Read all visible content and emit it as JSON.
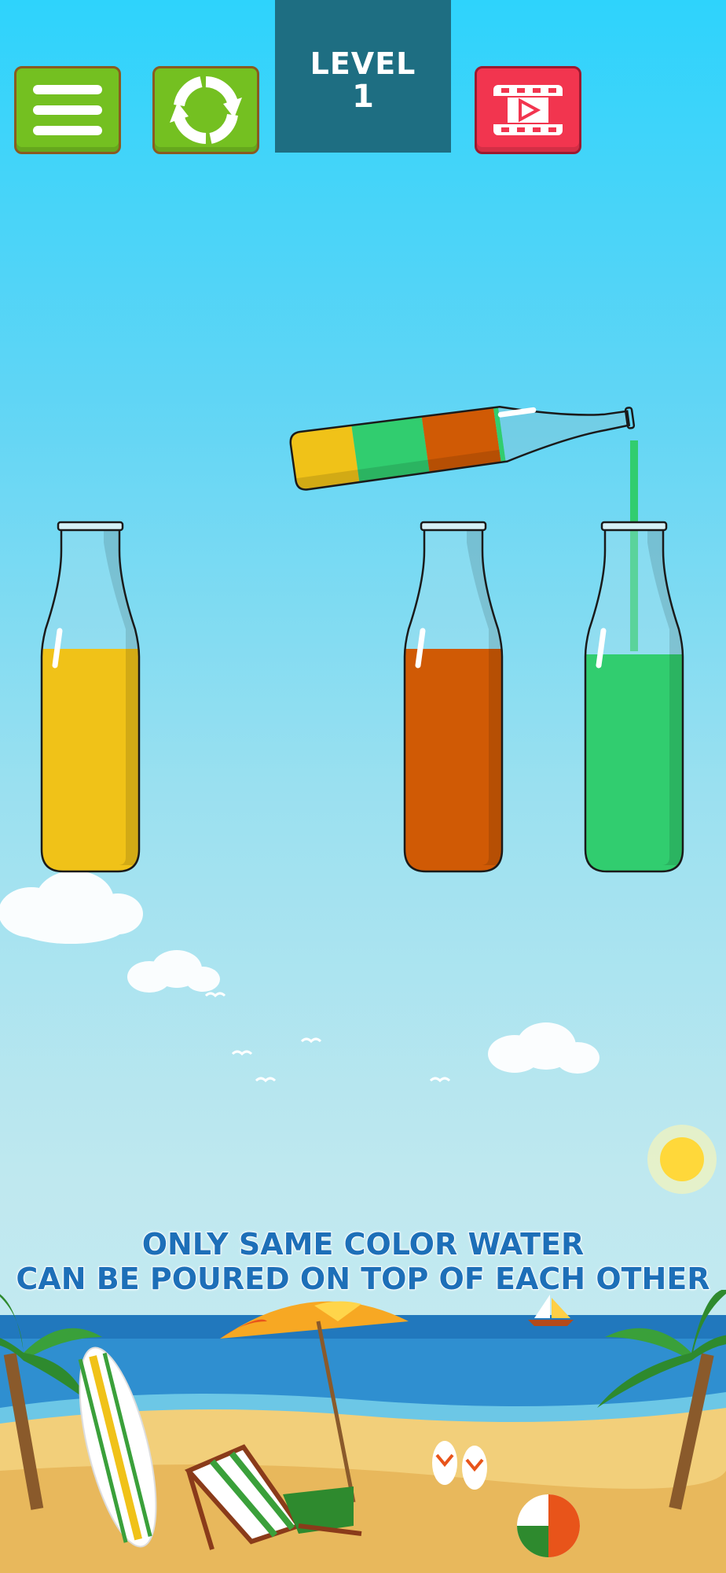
{
  "header": {
    "menu_button_icon": "menu-icon",
    "restart_button_icon": "restart-icon",
    "level_label": "LEVEL",
    "level_number": "1",
    "video_button_icon": "video-play-icon"
  },
  "bottles": [
    {
      "name": "bottle-yellow",
      "layers": [
        "#f0c218"
      ]
    },
    {
      "name": "bottle-orange",
      "layers": [
        "#d05a05"
      ]
    },
    {
      "name": "bottle-green",
      "layers": [
        "#31cd6f"
      ]
    }
  ],
  "tilted_bottle": {
    "layers_bottom_to_top": [
      "#f0c218",
      "#31cd6f",
      "#d05a05"
    ],
    "pouring_color": "#31cd6f"
  },
  "hint": {
    "line1": "ONLY SAME COLOR WATER",
    "line2": "CAN BE POURED ON TOP OF EACH OTHER"
  },
  "colors": {
    "yellow": "#f0c218",
    "green": "#31cd6f",
    "orange": "#d05a05",
    "button_green": "#74c021",
    "button_red": "#f2354f",
    "level_panel": "#1e6e82"
  }
}
